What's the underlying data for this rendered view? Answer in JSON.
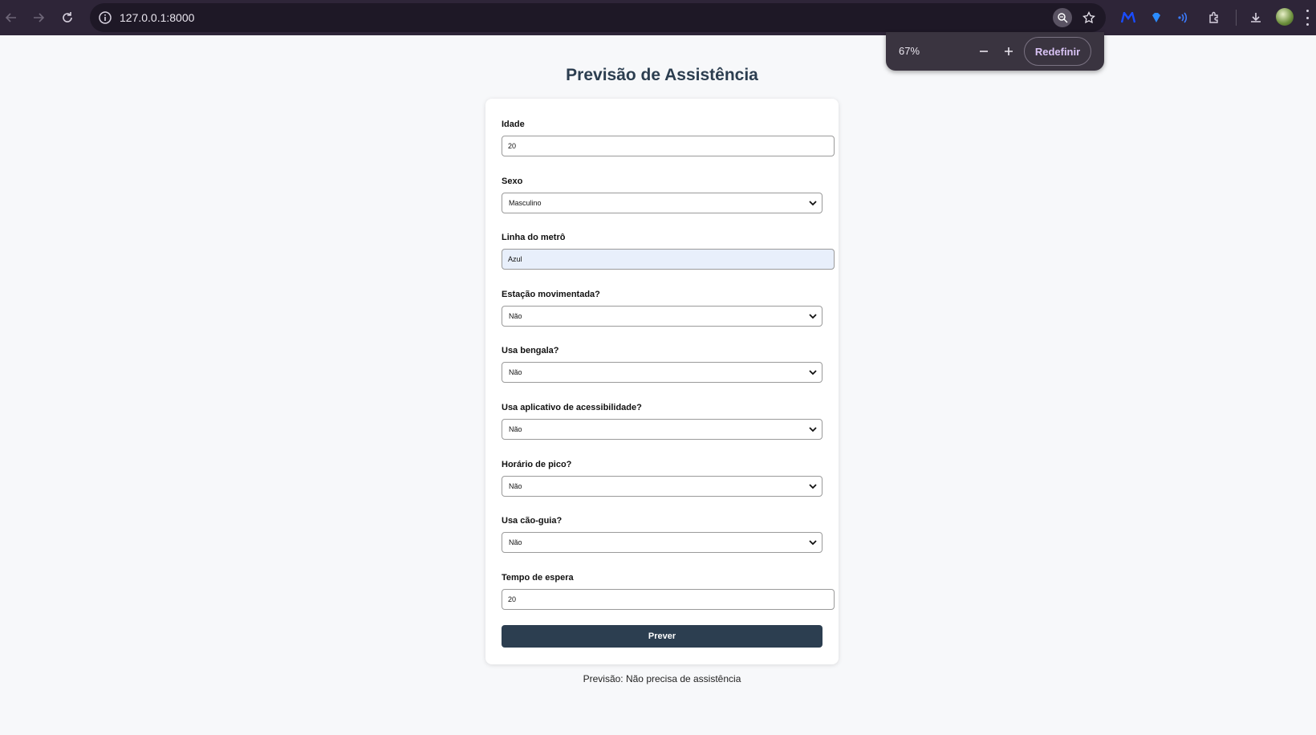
{
  "browser": {
    "url": "127.0.0.1:8000",
    "zoom_popup": {
      "level": "67%",
      "reset_label": "Redefinir"
    }
  },
  "page": {
    "title": "Previsão de Assistência",
    "fields": {
      "idade": {
        "label": "Idade",
        "value": "20"
      },
      "sexo": {
        "label": "Sexo",
        "value": "Masculino"
      },
      "linha": {
        "label": "Linha do metrô",
        "value": "Azul"
      },
      "estacao": {
        "label": "Estação movimentada?",
        "value": "Não"
      },
      "bengala": {
        "label": "Usa bengala?",
        "value": "Não"
      },
      "aplicativo": {
        "label": "Usa aplicativo de acessibilidade?",
        "value": "Não"
      },
      "pico": {
        "label": "Horário de pico?",
        "value": "Não"
      },
      "caoguia": {
        "label": "Usa cão-guia?",
        "value": "Não"
      },
      "espera": {
        "label": "Tempo de espera",
        "value": "20"
      }
    },
    "submit_label": "Prever",
    "result": "Previsão: Não precisa de assistência"
  },
  "colors": {
    "chrome_bg": "#2e2538",
    "page_bg": "#f7f8fa",
    "accent": "#2c3e50",
    "autofill_bg": "#e8effb",
    "reset_text": "#d9c3f5"
  }
}
